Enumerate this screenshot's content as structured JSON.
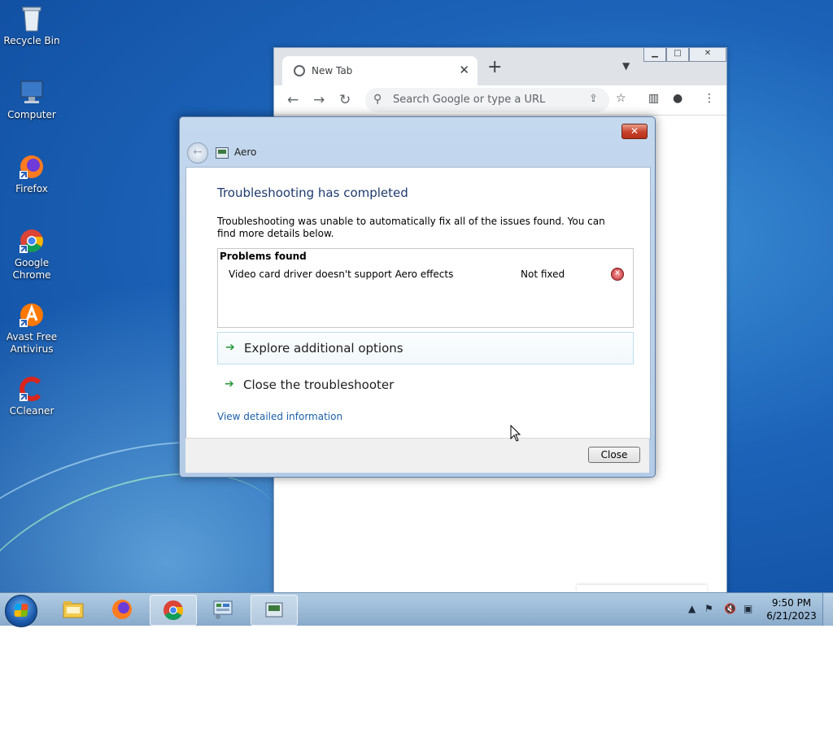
{
  "desktop": {
    "icons": [
      {
        "label": "Recycle Bin",
        "icon": "recycle-bin-icon"
      },
      {
        "label": "Computer",
        "icon": "computer-icon"
      },
      {
        "label": "Firefox",
        "icon": "firefox-icon"
      },
      {
        "label": "Google Chrome",
        "icon": "chrome-icon"
      },
      {
        "label": "Avast Free Antivirus",
        "icon": "avast-icon"
      },
      {
        "label": "CCleaner",
        "icon": "ccleaner-icon"
      }
    ]
  },
  "chrome": {
    "tab_title": "New Tab",
    "tab_close": "✕",
    "new_tab": "+",
    "omnibox_placeholder": "Search Google or type a URL"
  },
  "dialog": {
    "app_title": "Aero",
    "heading": "Troubleshooting has completed",
    "description": "Troubleshooting was unable to automatically fix all of the issues found. You can find more details below.",
    "problems_header": "Problems found",
    "problems": [
      {
        "name": "Video card driver doesn't support Aero effects",
        "status": "Not fixed"
      }
    ],
    "option_explore": "Explore additional options",
    "option_close": "Close the troubleshooter",
    "details_link": "View detailed information",
    "close_button": "Close"
  },
  "taskbar": {
    "time": "9:50 PM",
    "date": "6/21/2023"
  }
}
